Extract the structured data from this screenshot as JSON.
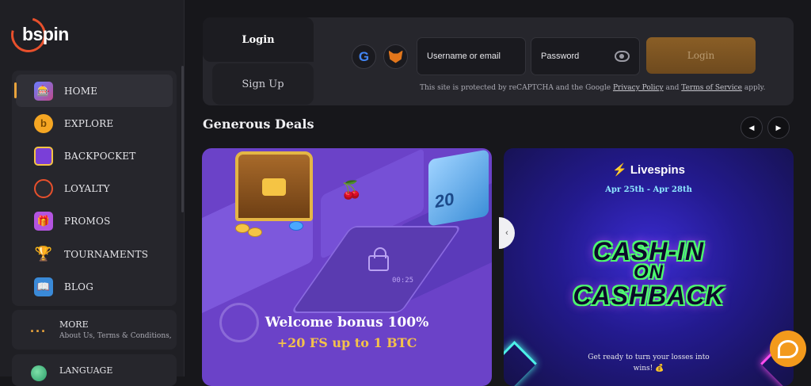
{
  "brand": {
    "name": "bspin",
    "accent": "#e8502c"
  },
  "nav": {
    "items": [
      {
        "label": "HOME",
        "icon": "home-icon",
        "active": true
      },
      {
        "label": "EXPLORE",
        "icon": "bitcoin-coin-icon"
      },
      {
        "label": "BACKPOCKET",
        "icon": "backpocket-icon"
      },
      {
        "label": "LOYALTY",
        "icon": "loyalty-icon"
      },
      {
        "label": "PROMOS",
        "icon": "gift-icon"
      },
      {
        "label": "TOURNAMENTS",
        "icon": "trophy-icon"
      },
      {
        "label": "BLOG",
        "icon": "blog-icon"
      }
    ],
    "more": {
      "title": "MORE",
      "subtitle": "About Us, Terms & Conditions, ..."
    },
    "language": {
      "label": "LANGUAGE"
    }
  },
  "auth": {
    "tab_login": "Login",
    "tab_signup": "Sign Up",
    "google_icon": "google-icon",
    "metamask_icon": "metamask-icon",
    "username_placeholder": "Username or email",
    "password_placeholder": "Password",
    "login_button": "Login",
    "recaptcha_text_1": "This site is protected by reCAPTCHA and the Google ",
    "privacy_link": "Privacy Policy",
    "recaptcha_and": " and ",
    "terms_link": "Terms of Service",
    "recaptcha_text_2": " apply."
  },
  "deals": {
    "title": "Generous Deals",
    "cards": [
      {
        "line1": "Welcome bonus 100%",
        "line2": "+20 FS up to 1 BTC",
        "dice_label": "20",
        "timer": "00:25"
      },
      {
        "brand": "Livespins",
        "dates": "Apr 25th - Apr 28th",
        "headline_1": "CASH-IN",
        "headline_2": "ON",
        "headline_3": "CASHBACK",
        "description": "Get ready to turn your losses into wins! 💰"
      }
    ]
  },
  "colors": {
    "gold": "#f3c14b",
    "purple": "#6b42c8",
    "neon_green": "#4dff6e",
    "support": "#f39a1c"
  }
}
